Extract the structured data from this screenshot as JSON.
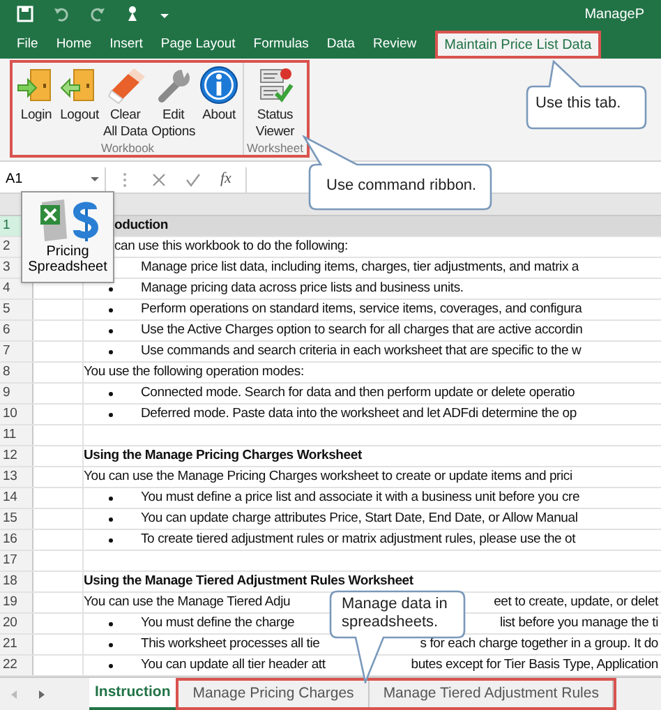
{
  "title_bar": {
    "title": "ManageP"
  },
  "ribbon_tabs": [
    {
      "label": "File",
      "selected": false
    },
    {
      "label": "Home",
      "selected": false
    },
    {
      "label": "Insert",
      "selected": false
    },
    {
      "label": "Page Layout",
      "selected": false
    },
    {
      "label": "Formulas",
      "selected": false
    },
    {
      "label": "Data",
      "selected": false
    },
    {
      "label": "Review",
      "selected": false
    },
    {
      "label": "Maintain Price List Data",
      "selected": true
    }
  ],
  "ribbon_groups": [
    {
      "label": "Workbook",
      "buttons": [
        {
          "kind": "login",
          "lines": [
            "Login"
          ]
        },
        {
          "kind": "logout",
          "lines": [
            "Logout"
          ]
        },
        {
          "kind": "clear",
          "lines": [
            "Clear",
            "All Data"
          ]
        },
        {
          "kind": "edit",
          "lines": [
            "Edit",
            "Options"
          ]
        },
        {
          "kind": "about",
          "lines": [
            "About"
          ]
        }
      ]
    },
    {
      "label": "Worksheet",
      "buttons": [
        {
          "kind": "status",
          "lines": [
            "Status",
            "Viewer"
          ]
        }
      ]
    }
  ],
  "formula_bar": {
    "name_box": "A1",
    "function_label": "fx"
  },
  "floating_icon": {
    "lines": [
      "Pricing",
      "Spreadsheet"
    ]
  },
  "rows": [
    {
      "number": "1",
      "kind": "title",
      "partly_hidden": true,
      "text": "oduction"
    },
    {
      "number": "2",
      "kind": "text",
      "partly_hidden": true,
      "text": "can use this workbook to do the following:"
    },
    {
      "number": "3",
      "kind": "bullet",
      "text": "Manage price list data, including items, charges, tier adjustments, and matrix a"
    },
    {
      "number": "4",
      "kind": "bullet",
      "text": "Manage pricing data across price lists and business units."
    },
    {
      "number": "5",
      "kind": "bullet",
      "text": "Perform operations on standard items, service items, coverages, and configura"
    },
    {
      "number": "6",
      "kind": "bullet",
      "text": "Use the Active Charges option to search for all charges that are active accordin"
    },
    {
      "number": "7",
      "kind": "bullet",
      "text": "Use commands and search criteria in each worksheet that are specific to the w"
    },
    {
      "number": "8",
      "kind": "text",
      "text": "You use the following operation modes:"
    },
    {
      "number": "9",
      "kind": "bullet",
      "text": "Connected mode. Search for data and then perform update or delete operatio"
    },
    {
      "number": "10",
      "kind": "bullet",
      "text": "Deferred mode. Paste data into the worksheet and let ADFdi determine the op"
    },
    {
      "number": "11",
      "kind": "blank"
    },
    {
      "number": "12",
      "kind": "heading",
      "text": "Using the Manage Pricing Charges Worksheet"
    },
    {
      "number": "13",
      "kind": "text",
      "text": "You can use the Manage Pricing Charges worksheet to create or update items and prici"
    },
    {
      "number": "14",
      "kind": "bullet",
      "text": "You must define a price list and associate it with a business unit before you cre"
    },
    {
      "number": "15",
      "kind": "bullet",
      "text": "You can update charge attributes Price, Start Date, End Date, or Allow Manual"
    },
    {
      "number": "16",
      "kind": "bullet",
      "text": "To create tiered adjustment rules or matrix adjustment rules, please use the ot"
    },
    {
      "number": "17",
      "kind": "blank"
    },
    {
      "number": "18",
      "kind": "heading",
      "text": "Using the Manage Tiered Adjustment Rules Worksheet"
    },
    {
      "number": "19",
      "kind": "text",
      "text": "You can use the Manage Tiered Adju",
      "text_after": "eet to create, update, or delet"
    },
    {
      "number": "20",
      "kind": "bullet",
      "text": "You must define the charge",
      "text_after": "list before you manage the ti"
    },
    {
      "number": "21",
      "kind": "bullet",
      "text": "This worksheet processes all tie",
      "text_after": "s for each charge together in a group. It do"
    },
    {
      "number": "22",
      "kind": "bullet",
      "text": "You can update all tier header att",
      "text_after": "butes except for Tier Basis Type, Application"
    }
  ],
  "sheet_tabs": [
    {
      "label": "Instruction",
      "selected": true
    },
    {
      "label": "Manage Pricing Charges",
      "selected": false
    },
    {
      "label": "Manage Tiered Adjustment Rules",
      "selected": false
    }
  ],
  "callouts": [
    {
      "text": "Use this tab."
    },
    {
      "text": "Use command ribbon."
    },
    {
      "text": "Manage data in spreadsheets."
    }
  ]
}
